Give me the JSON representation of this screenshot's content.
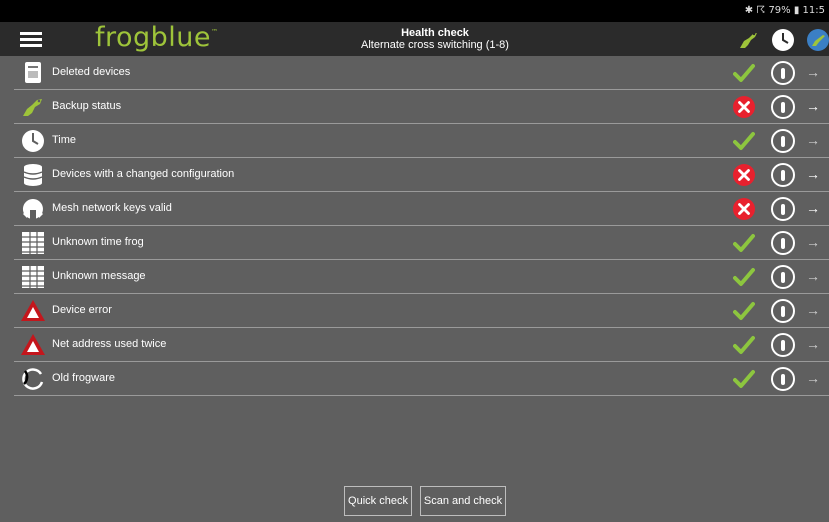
{
  "status_bar": {
    "right_text": "✱ ☈ 79% ▮ 11:5"
  },
  "app_bar": {
    "logo": "frogblue",
    "logo_tm": "™",
    "title": "Health check",
    "subtitle": "Alternate cross switching (1-8)",
    "icons": [
      "frog-icon",
      "clock-icon",
      "globe-frog-icon"
    ]
  },
  "checks": [
    {
      "label": "Deleted devices",
      "icon": "document-icon",
      "status": "ok",
      "arrow_active": false
    },
    {
      "label": "Backup status",
      "icon": "frog-icon",
      "status": "error",
      "arrow_active": true
    },
    {
      "label": "Time",
      "icon": "clock-icon",
      "status": "ok",
      "arrow_active": false
    },
    {
      "label": "Devices with a changed configuration",
      "icon": "database-icon",
      "status": "error",
      "arrow_active": true
    },
    {
      "label": "Mesh network keys valid",
      "icon": "network-icon",
      "status": "error",
      "arrow_active": true
    },
    {
      "label": "Unknown time frog",
      "icon": "grid-icon",
      "status": "ok",
      "arrow_active": false
    },
    {
      "label": "Unknown message",
      "icon": "grid-icon",
      "status": "ok",
      "arrow_active": false
    },
    {
      "label": "Device error",
      "icon": "warning-icon",
      "status": "ok",
      "arrow_active": false
    },
    {
      "label": "Net address used twice",
      "icon": "warning-icon",
      "status": "ok",
      "arrow_active": false
    },
    {
      "label": "Old frogware",
      "icon": "refresh-icon",
      "status": "ok",
      "arrow_active": false
    }
  ],
  "arrow_glyph": "→",
  "buttons": {
    "quick_check": "Quick check",
    "scan_and_check": "Scan and check"
  },
  "colors": {
    "ok": "#8dc63f",
    "error": "#e8212e",
    "brand": "#9ec43a",
    "warning": "#c4161c"
  }
}
